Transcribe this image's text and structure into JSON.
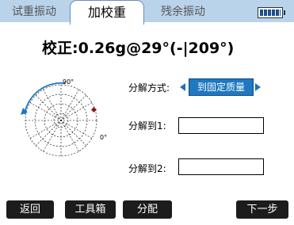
{
  "tabs": [
    "试重振动",
    "加校重",
    "残余振动"
  ],
  "correction_text": "校正:0.26g@29°(-|209°)",
  "polar": {
    "label_90": "90°",
    "label_0": "0°"
  },
  "decompose_method_label": "分解方式:",
  "decompose_method_value": "到固定质量",
  "decompose_to_1_label": "分解到1:",
  "decompose_to_1_value": "",
  "decompose_to_2_label": "分解到2:",
  "decompose_to_2_value": "",
  "buttons": [
    "返回",
    "工具箱",
    "分配",
    "下一步"
  ],
  "colors": {
    "accent": "#1f78c1",
    "tab_bar": "#b9d3ea",
    "marker": "#8b1a1a"
  }
}
